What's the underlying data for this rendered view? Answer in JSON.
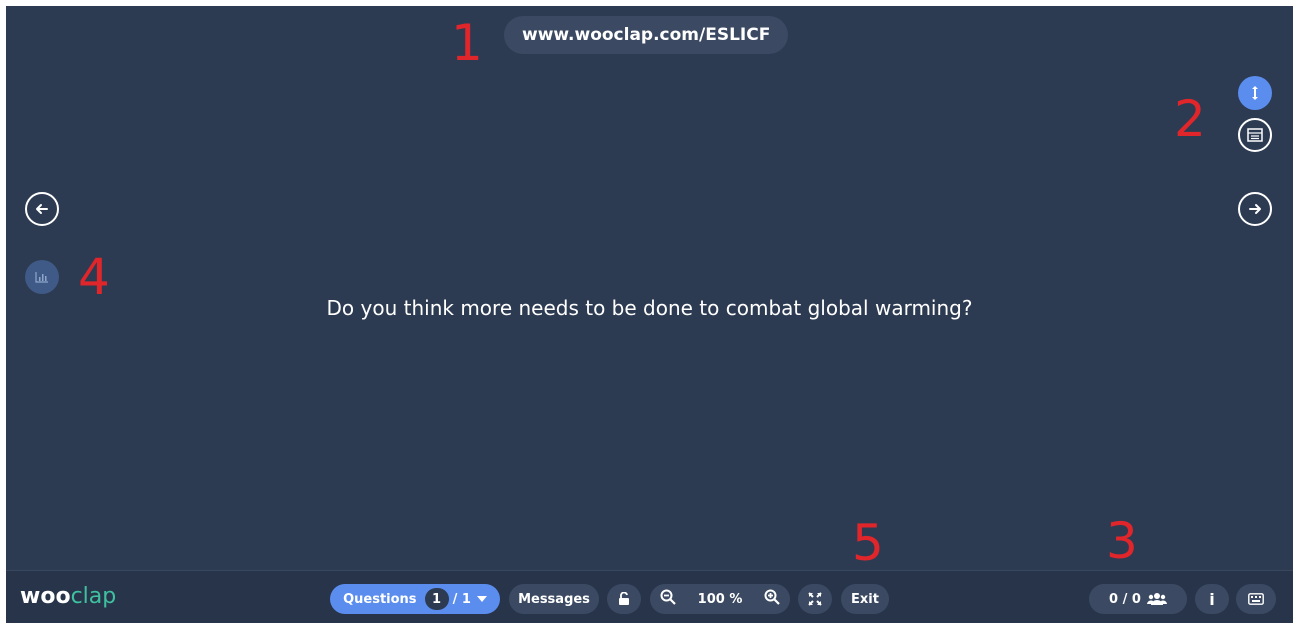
{
  "app": {
    "url": "www.wooclap.com/ESLICF"
  },
  "annotations": [
    "1",
    "2",
    "3",
    "4",
    "5"
  ],
  "question": {
    "text": "Do you think more needs to be done to combat global warming?"
  },
  "side_controls": {
    "left_arrow_icon": "arrow-left-icon",
    "right_arrow_icon": "arrow-right-icon",
    "resize_icon": "vertical-resize-icon",
    "layout_icon": "layout-toggle-icon",
    "results_icon": "bar-chart-icon"
  },
  "toolbar": {
    "logo_part1": "woo",
    "logo_part2": "clap",
    "questions_label": "Questions",
    "question_current": "1",
    "question_total": "/ 1",
    "messages_label": "Messages",
    "zoom": "100 %",
    "exit_label": "Exit",
    "participants": "0 / 0",
    "info_label": "i"
  },
  "colors": {
    "stage_bg": "#2d3b52",
    "accent": "#5b8def",
    "brand_green": "#3fc1a0",
    "annotation_red": "#e0262b"
  }
}
